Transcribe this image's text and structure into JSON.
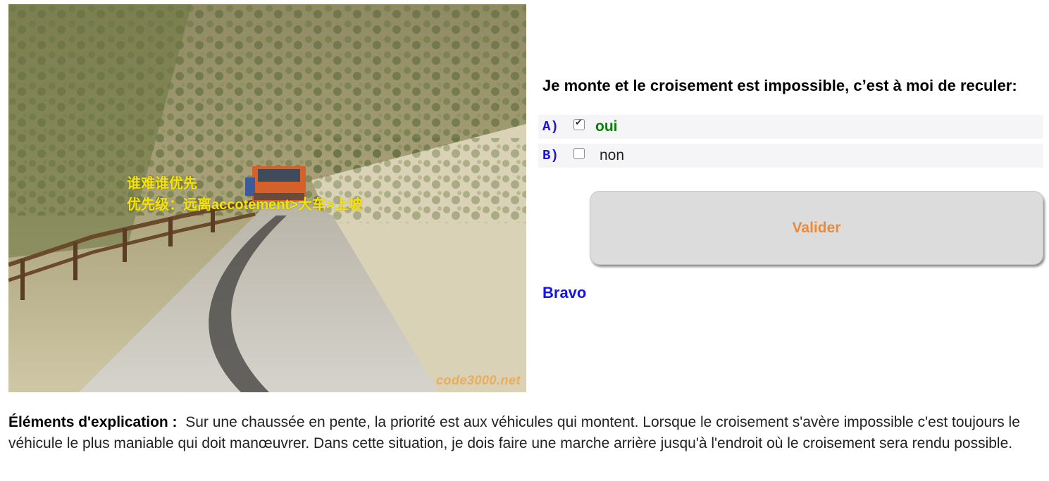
{
  "photo": {
    "overlay_line1": "谁难谁优先",
    "overlay_line2": "优先级：远离accotement>大车>上坡",
    "watermark": "code3000.net"
  },
  "question": {
    "text": "Je monte et le croisement est impossible, c’est à moi de reculer:"
  },
  "answers": [
    {
      "letter": "A)",
      "label": "oui",
      "checked": true,
      "state": "correct"
    },
    {
      "letter": "B)",
      "label": "non",
      "checked": false,
      "state": "neutral"
    }
  ],
  "submit_label": "Valider",
  "feedback": "Bravo",
  "explanation": {
    "heading": "Éléments d'explication :",
    "text": "Sur une chaussée en pente, la priorité est aux véhicules qui montent. Lorsque le croisement s'avère impossible c'est toujours le véhicule le plus maniable qui doit manœuvrer. Dans cette situation, je dois faire une marche arrière jusqu'à l'endroit où le croisement sera rendu possible."
  },
  "colors": {
    "overlay_text": "#f5e400",
    "answer_letter": "#1a14d6",
    "correct_answer": "#0a7d0a",
    "button_text": "#ec8a3a",
    "feedback": "#1414e6"
  }
}
